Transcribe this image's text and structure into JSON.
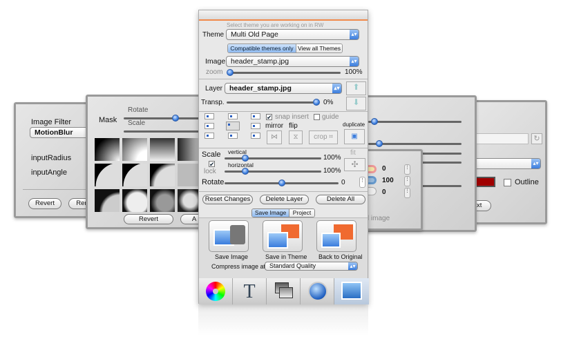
{
  "main": {
    "hint": "Select theme you are working on in RW",
    "theme_label": "Theme",
    "theme_value": "Multi Old Page",
    "seg_compatible": "Compatible themes only",
    "seg_all": "View all Themes",
    "image_label": "Image",
    "image_value": "header_stamp.jpg",
    "zoom_label": "zoom",
    "zoom_value": "100%",
    "zoom_level": 0,
    "layer_label": "Layer",
    "layer_value": "header_stamp.jpg",
    "transp_label": "Transp.",
    "transp_value": "0%",
    "transp_level": 1,
    "snap_insert": "snap insert",
    "snap_checked": true,
    "guide": "guide",
    "guide_checked": false,
    "mirror": "mirror",
    "flip": "flip",
    "crop": "crop",
    "duplicate": "duplicate",
    "scale_label": "Scale",
    "vertical": "vertical",
    "vertical_value": "100%",
    "horizontal": "horizontal",
    "horizontal_value": "100%",
    "lock": "lock",
    "lock_checked": true,
    "fit": "fit",
    "rotate_label": "Rotate",
    "rotate_value": "0",
    "reset": "Reset Changes",
    "delete_layer": "Delete Layer",
    "delete_all": "Delete All",
    "tab_save": "Save Image",
    "tab_project": "Project",
    "save_image": "Save Image",
    "save_theme": "Save in Theme",
    "back_original": "Back to Original",
    "compress_label": "Compress image at",
    "compress_value": "Standard Quality",
    "toolbar": [
      "color-wheel-icon",
      "text-icon",
      "layers-icon",
      "globe-icon",
      "image-icon"
    ]
  },
  "filter_panel": {
    "title": "Image Filter",
    "value": "MotionBlur",
    "radius": "inputRadius",
    "angle": "inputAngle",
    "revert": "Revert",
    "render": "Ren"
  },
  "mask_panel": {
    "mask": "Mask",
    "rotate": "Rotate",
    "scale": "Scale",
    "revert": "Revert",
    "apply": "A"
  },
  "color_panel": {
    "v1": "0",
    "v2": "100",
    "v3": "0",
    "caption": "ed image"
  },
  "text_panel": {
    "outline": "Outline",
    "next": "ext",
    "color": "#a00000"
  }
}
